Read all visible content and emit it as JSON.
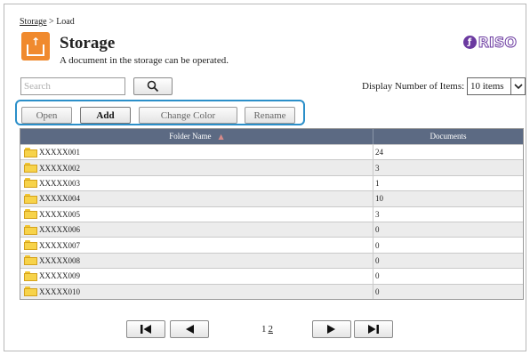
{
  "breadcrumb": {
    "link": "Storage",
    "separator": " > ",
    "current": "Load"
  },
  "header": {
    "title": "Storage",
    "subtitle": "A document in the storage can be operated.",
    "brand": "RISO"
  },
  "search": {
    "placeholder": "Search",
    "value": "",
    "button_icon": "magnifier-icon"
  },
  "display_items": {
    "label": "Display Number of Items:",
    "selected": "10 items"
  },
  "actions": {
    "open": "Open",
    "add": "Add",
    "change_color": "Change Color",
    "rename": "Rename",
    "highlight_color": "#2b8fc9"
  },
  "table": {
    "columns": [
      "Folder Name",
      "Documents"
    ],
    "rows": [
      {
        "name": "XXXXX001",
        "docs": "24"
      },
      {
        "name": "XXXXX002",
        "docs": "3"
      },
      {
        "name": "XXXXX003",
        "docs": "1"
      },
      {
        "name": "XXXXX004",
        "docs": "10"
      },
      {
        "name": "XXXXX005",
        "docs": "3"
      },
      {
        "name": "XXXXX006",
        "docs": "0"
      },
      {
        "name": "XXXXX007",
        "docs": "0"
      },
      {
        "name": "XXXXX008",
        "docs": "0"
      },
      {
        "name": "XXXXX009",
        "docs": "0"
      },
      {
        "name": "XXXXX010",
        "docs": "0"
      }
    ]
  },
  "pagination": {
    "current": "1",
    "next": "2"
  },
  "colors": {
    "accent": "#f08a2e",
    "header_bg": "#5c6a83",
    "brand": "#6b3aa0"
  }
}
